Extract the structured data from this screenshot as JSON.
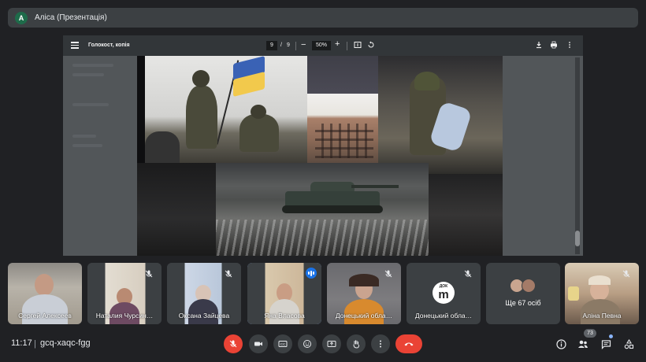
{
  "presenter": {
    "avatar_letter": "A",
    "name": "Аліса (Презентація)"
  },
  "pdf_viewer": {
    "title": "Голокост, копія",
    "current_page": "9",
    "page_separator": "/",
    "total_pages": "9",
    "zoom": "50%",
    "zoom_minus": "−",
    "zoom_plus": "+"
  },
  "participants": [
    {
      "name": "Сергей Алексеев",
      "muted": false,
      "speaking": false
    },
    {
      "name": "Наталия Чурсин…",
      "muted": true,
      "speaking": false
    },
    {
      "name": "Оксана Зайцева",
      "muted": true,
      "speaking": false
    },
    {
      "name": "Яна Власова",
      "muted": false,
      "speaking": true
    },
    {
      "name": "Донецький обла…",
      "muted": true,
      "speaking": false
    },
    {
      "name": "Донецький обла…",
      "muted": true,
      "speaking": false,
      "logo_top": "ДОК",
      "logo_letter": "m"
    },
    {
      "name": "Ще 67 осіб",
      "muted": false,
      "speaking": false
    },
    {
      "name": "Аліна Певна",
      "muted": true,
      "speaking": false
    }
  ],
  "meeting": {
    "time": "11:17",
    "divider": "|",
    "code": "gcq-xaqc-fgg",
    "people_count": "73"
  },
  "colors": {
    "background": "#202124",
    "tile": "#3c4043",
    "accent_blue": "#8ab4f8",
    "danger_red": "#ea4335"
  },
  "icons": {
    "controls": [
      "mic-off-icon",
      "camera-icon",
      "captions-icon",
      "emoji-icon",
      "present-screen-icon",
      "raise-hand-icon",
      "more-options-icon",
      "end-call-icon"
    ],
    "right": [
      "info-icon",
      "people-icon",
      "chat-icon",
      "activities-icon"
    ],
    "pdf_toolbar": [
      "menu-icon",
      "fit-page-icon",
      "rotate-icon",
      "download-icon",
      "print-icon",
      "more-vert-icon"
    ]
  }
}
